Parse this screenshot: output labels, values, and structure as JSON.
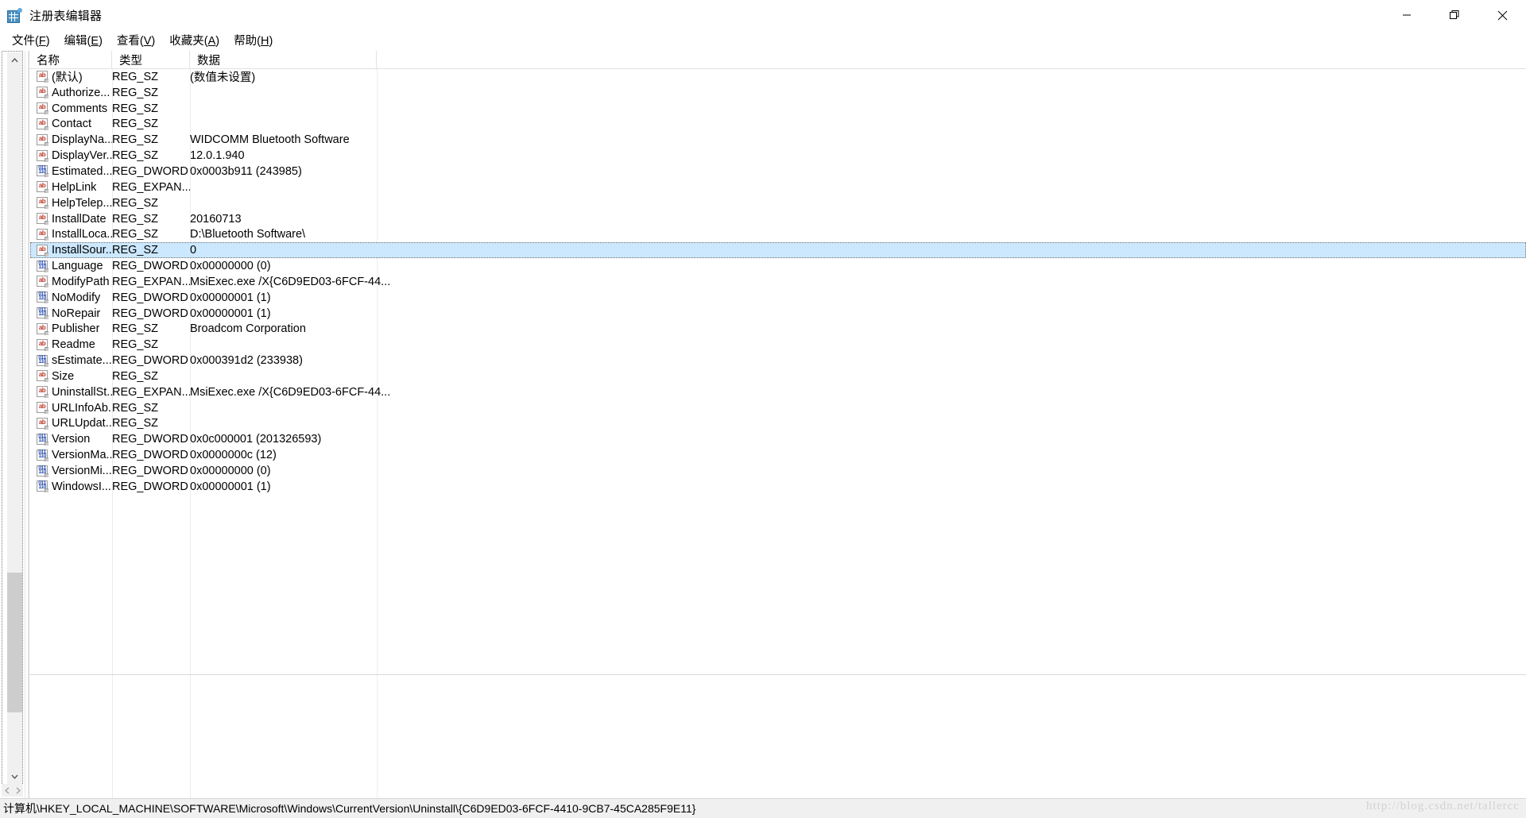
{
  "window": {
    "title": "注册表编辑器",
    "icon": "registry-editor-icon",
    "controls": {
      "minimize": "最小化",
      "restore": "还原",
      "close": "关闭"
    }
  },
  "menubar": {
    "items": [
      {
        "label": "文件",
        "accel": "F"
      },
      {
        "label": "编辑",
        "accel": "E"
      },
      {
        "label": "查看",
        "accel": "V"
      },
      {
        "label": "收藏夹",
        "accel": "A"
      },
      {
        "label": "帮助",
        "accel": "H"
      }
    ]
  },
  "list": {
    "columns": [
      {
        "key": "name",
        "label": "名称"
      },
      {
        "key": "type",
        "label": "类型"
      },
      {
        "key": "data",
        "label": "数据"
      }
    ],
    "rows": [
      {
        "icon": "string-value-icon",
        "name": "(默认)",
        "type": "REG_SZ",
        "data": "(数值未设置)",
        "selected": false
      },
      {
        "icon": "string-value-icon",
        "name": "Authorize...",
        "type": "REG_SZ",
        "data": "",
        "selected": false
      },
      {
        "icon": "string-value-icon",
        "name": "Comments",
        "type": "REG_SZ",
        "data": "",
        "selected": false
      },
      {
        "icon": "string-value-icon",
        "name": "Contact",
        "type": "REG_SZ",
        "data": "",
        "selected": false
      },
      {
        "icon": "string-value-icon",
        "name": "DisplayNa...",
        "type": "REG_SZ",
        "data": "WIDCOMM Bluetooth Software",
        "selected": false
      },
      {
        "icon": "string-value-icon",
        "name": "DisplayVer...",
        "type": "REG_SZ",
        "data": "12.0.1.940",
        "selected": false
      },
      {
        "icon": "dword-value-icon",
        "name": "Estimated...",
        "type": "REG_DWORD",
        "data": "0x0003b911 (243985)",
        "selected": false
      },
      {
        "icon": "string-value-icon",
        "name": "HelpLink",
        "type": "REG_EXPAN...",
        "data": "",
        "selected": false
      },
      {
        "icon": "string-value-icon",
        "name": "HelpTelep...",
        "type": "REG_SZ",
        "data": "",
        "selected": false
      },
      {
        "icon": "string-value-icon",
        "name": "InstallDate",
        "type": "REG_SZ",
        "data": "20160713",
        "selected": false
      },
      {
        "icon": "string-value-icon",
        "name": "InstallLoca...",
        "type": "REG_SZ",
        "data": "D:\\Bluetooth Software\\",
        "selected": false
      },
      {
        "icon": "string-value-icon",
        "name": "InstallSour...",
        "type": "REG_SZ",
        "data": "0",
        "selected": true
      },
      {
        "icon": "dword-value-icon",
        "name": "Language",
        "type": "REG_DWORD",
        "data": "0x00000000 (0)",
        "selected": false
      },
      {
        "icon": "string-value-icon",
        "name": "ModifyPath",
        "type": "REG_EXPAN...",
        "data": "MsiExec.exe /X{C6D9ED03-6FCF-44...",
        "selected": false
      },
      {
        "icon": "dword-value-icon",
        "name": "NoModify",
        "type": "REG_DWORD",
        "data": "0x00000001 (1)",
        "selected": false
      },
      {
        "icon": "dword-value-icon",
        "name": "NoRepair",
        "type": "REG_DWORD",
        "data": "0x00000001 (1)",
        "selected": false
      },
      {
        "icon": "string-value-icon",
        "name": "Publisher",
        "type": "REG_SZ",
        "data": "Broadcom Corporation",
        "selected": false
      },
      {
        "icon": "string-value-icon",
        "name": "Readme",
        "type": "REG_SZ",
        "data": "",
        "selected": false
      },
      {
        "icon": "dword-value-icon",
        "name": "sEstimate...",
        "type": "REG_DWORD",
        "data": "0x000391d2 (233938)",
        "selected": false
      },
      {
        "icon": "string-value-icon",
        "name": "Size",
        "type": "REG_SZ",
        "data": "",
        "selected": false
      },
      {
        "icon": "string-value-icon",
        "name": "UninstallSt...",
        "type": "REG_EXPAN...",
        "data": "MsiExec.exe /X{C6D9ED03-6FCF-44...",
        "selected": false
      },
      {
        "icon": "string-value-icon",
        "name": "URLInfoAb...",
        "type": "REG_SZ",
        "data": "",
        "selected": false
      },
      {
        "icon": "string-value-icon",
        "name": "URLUpdat...",
        "type": "REG_SZ",
        "data": "",
        "selected": false
      },
      {
        "icon": "dword-value-icon",
        "name": "Version",
        "type": "REG_DWORD",
        "data": "0x0c000001 (201326593)",
        "selected": false
      },
      {
        "icon": "dword-value-icon",
        "name": "VersionMa...",
        "type": "REG_DWORD",
        "data": "0x0000000c (12)",
        "selected": false
      },
      {
        "icon": "dword-value-icon",
        "name": "VersionMi...",
        "type": "REG_DWORD",
        "data": "0x00000000 (0)",
        "selected": false
      },
      {
        "icon": "dword-value-icon",
        "name": "WindowsI...",
        "type": "REG_DWORD",
        "data": "0x00000001 (1)",
        "selected": false
      }
    ]
  },
  "statusbar": {
    "path": "计算机\\HKEY_LOCAL_MACHINE\\SOFTWARE\\Microsoft\\Windows\\CurrentVersion\\Uninstall\\{C6D9ED03-6FCF-4410-9CB7-45CA285F9E11}",
    "watermark": "http://blog.csdn.net/tallercc"
  },
  "colors": {
    "selection": "#cce8ff",
    "string_icon": "#c0392b",
    "dword_icon": "#2b4fb0",
    "statusbar_bg": "#f0f0f0"
  }
}
